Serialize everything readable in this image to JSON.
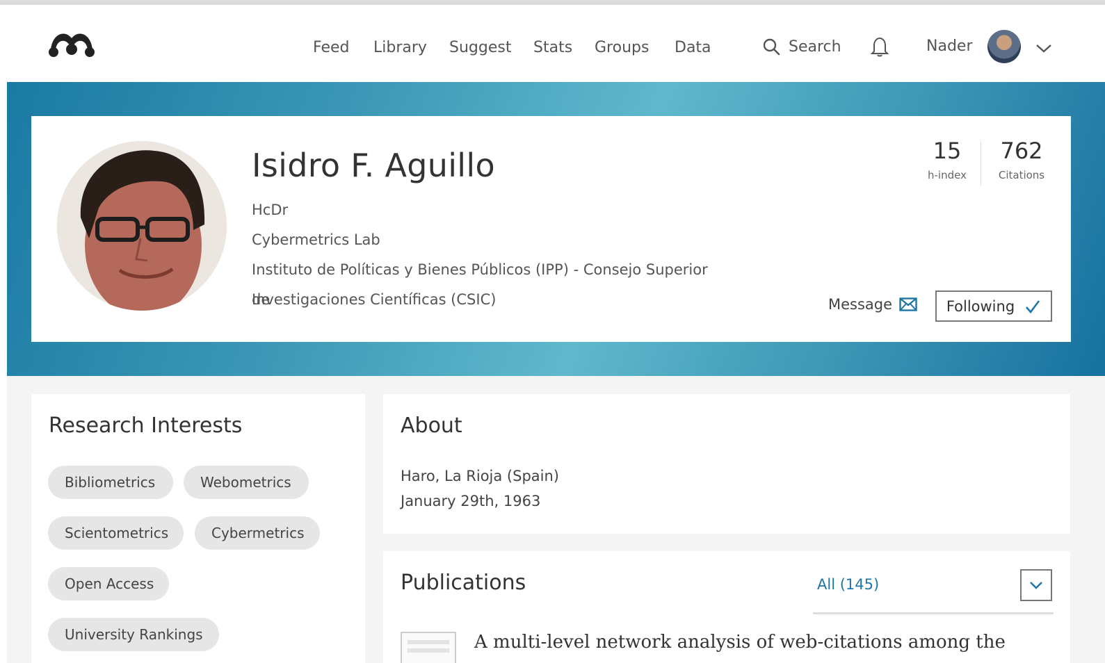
{
  "nav": {
    "links": [
      "Feed",
      "Library",
      "Suggest",
      "Stats",
      "Groups",
      "Data"
    ],
    "search_label": "Search",
    "user_name": "Nader"
  },
  "profile": {
    "name": "Isidro F. Aguillo",
    "title": "HcDr",
    "department": "Cybermetrics Lab",
    "institution_line1": "Instituto de Políticas y Bienes Públicos (IPP) - Consejo Superior de",
    "institution_line2": "Investigaciones Científicas (CSIC)",
    "h_index_value": "15",
    "h_index_label": "h-index",
    "citations_value": "762",
    "citations_label": "Citations",
    "message_label": "Message",
    "following_label": "Following"
  },
  "research_interests": {
    "title": "Research Interests",
    "chips": [
      "Bibliometrics",
      "Webometrics",
      "Scientometrics",
      "Cybermetrics",
      "Open Access",
      "University Rankings"
    ]
  },
  "about": {
    "title": "About",
    "location": "Haro, La Rioja (Spain)",
    "birthdate": "January 29th, 1963"
  },
  "publications": {
    "title": "Publications",
    "filter_label": "All (145)",
    "first_title": "A multi-level network analysis of web-citations among the"
  },
  "colors": {
    "accent": "#1e76a6",
    "hero_dark": "#1671a0",
    "hero_light": "#5fb8cc"
  }
}
